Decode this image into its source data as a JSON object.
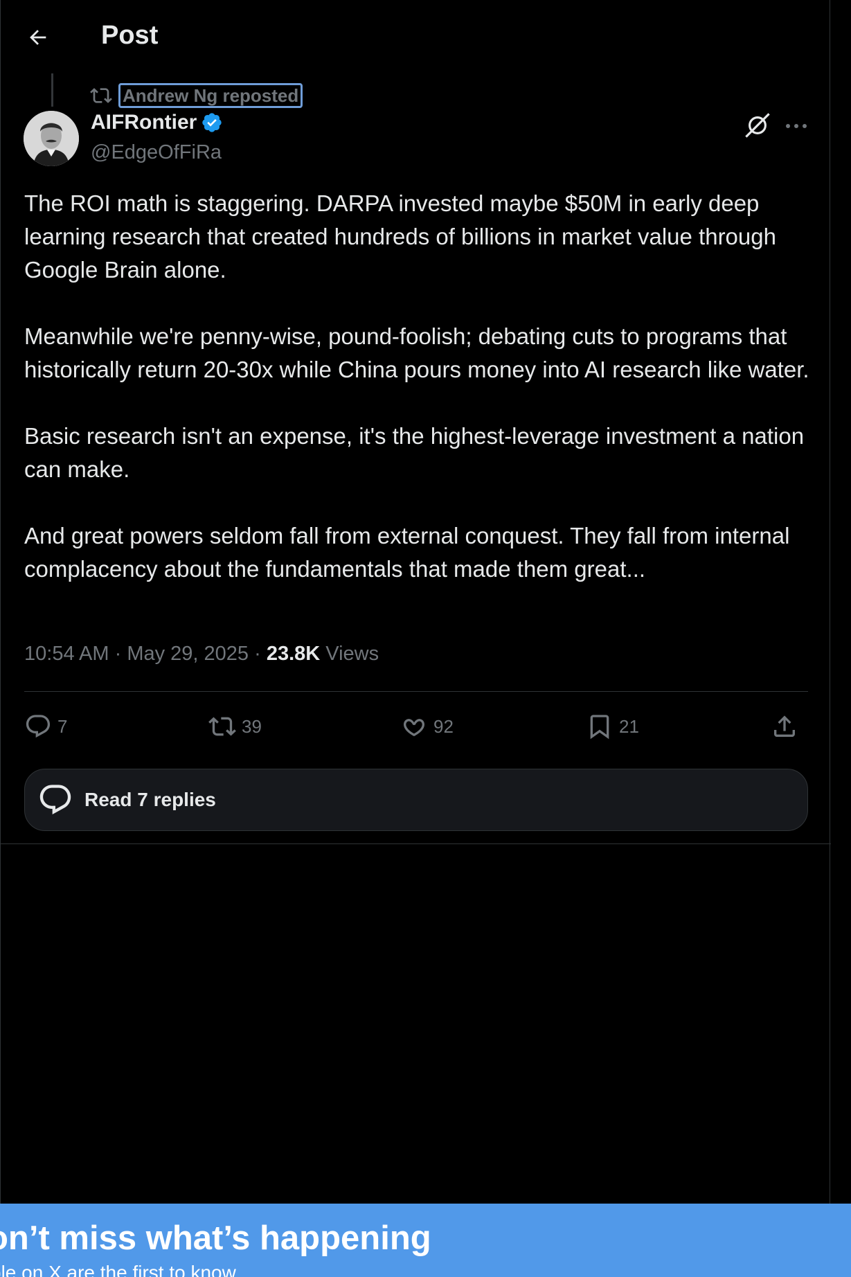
{
  "header": {
    "title": "Post"
  },
  "repost": {
    "label": "Andrew Ng reposted"
  },
  "author": {
    "name": "AIFRontier",
    "handle": "@EdgeOfFiRa"
  },
  "post": {
    "paragraphs": [
      "The ROI math is staggering. DARPA invested maybe $50M in early deep learning research that created hundreds of billions in market value through Google Brain alone.",
      "Meanwhile we're penny-wise, pound-foolish; debating cuts to programs that historically return 20-30x while China pours money into AI research like water.",
      "Basic research isn't an expense, it's the highest-leverage investment a nation can make.",
      "And great powers seldom fall from external conquest. They fall from internal complacency about the fundamentals that made them great..."
    ],
    "time": "10:54 AM",
    "date": "May 29, 2025",
    "views_count": "23.8K",
    "views_label": "Views"
  },
  "actions": {
    "replies": "7",
    "reposts": "39",
    "likes": "92",
    "bookmarks": "21"
  },
  "read_replies": {
    "label": "Read 7 replies"
  },
  "banner": {
    "title": "on’t miss what’s happening",
    "subtitle": "ple on X are the first to know."
  },
  "colors": {
    "accent": "#1d9bf0",
    "banner": "#5199e9",
    "muted": "#71767b"
  },
  "icons": [
    "back-arrow-icon",
    "repost-icon",
    "verified-icon",
    "grok-icon",
    "more-icon",
    "reply-icon",
    "like-icon",
    "bookmark-icon",
    "share-icon",
    "chat-bubble-icon"
  ]
}
